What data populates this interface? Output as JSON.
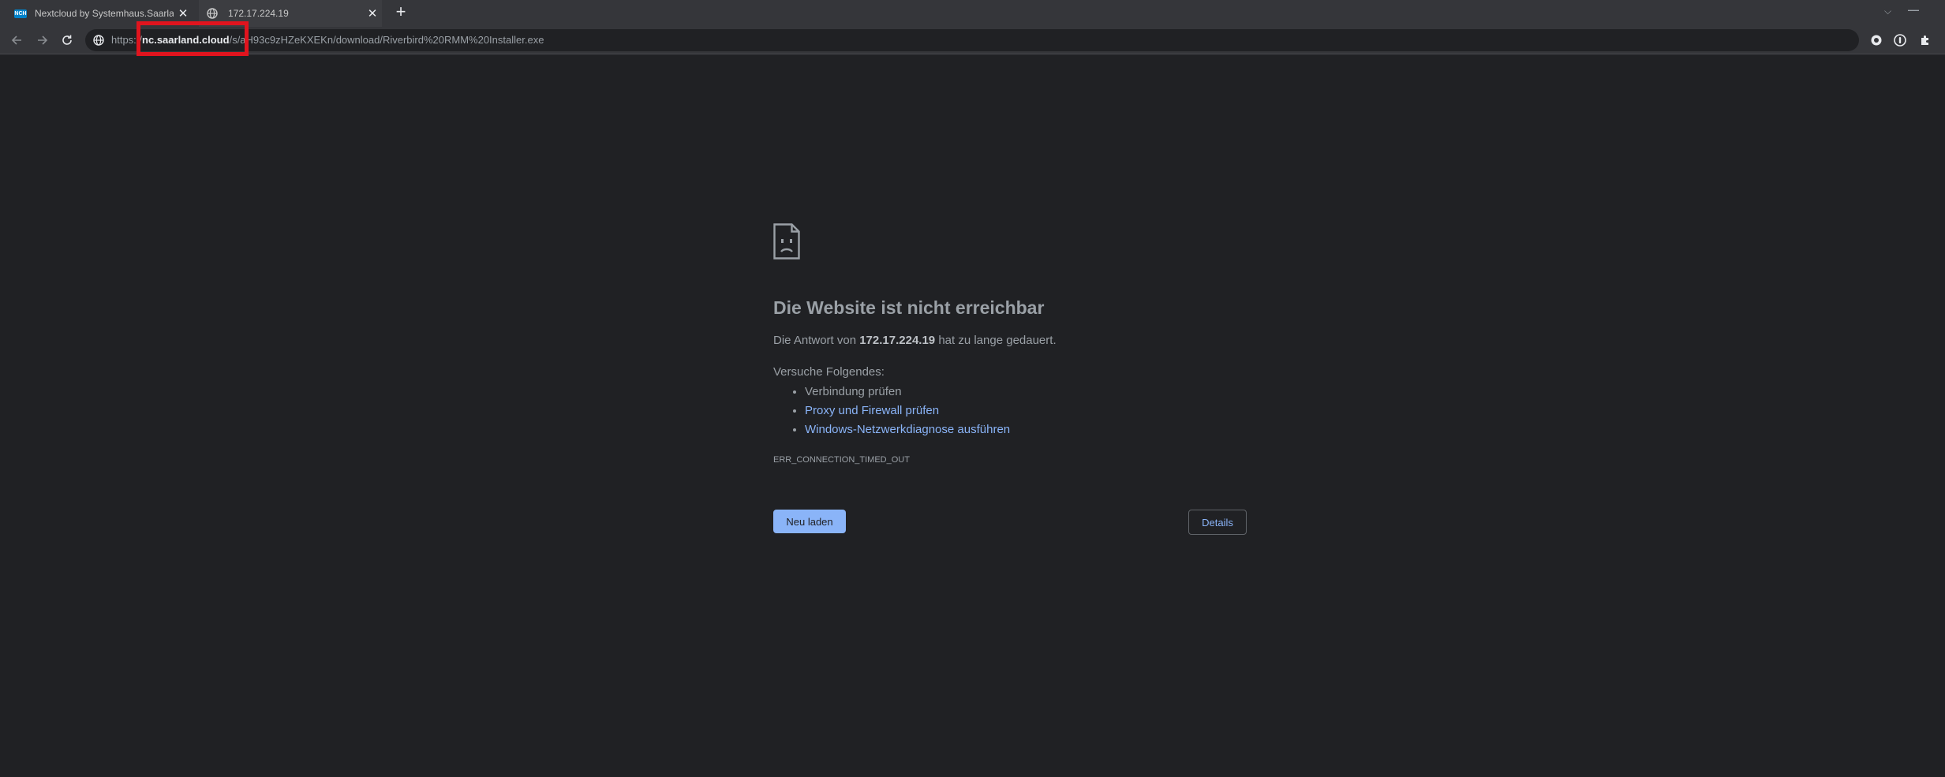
{
  "tabs": [
    {
      "title": "Nextcloud by Systemhaus.Saarland",
      "favicon_text": "NCH",
      "favicon": "nextcloud-icon"
    },
    {
      "title": "172.17.224.19",
      "favicon": "globe-icon"
    }
  ],
  "tab_close_glyph": "✕",
  "new_tab_glyph": "+",
  "window_controls": {
    "minimize": "—",
    "maximize": "☐",
    "close": "✕",
    "tab_search": "⌵"
  },
  "address_bar": {
    "scheme": "https://",
    "host": "nc.saarland.cloud",
    "path": "/s/aH93c9zHZeKXEKn/download/Riverbird%20RMM%20Installer.exe"
  },
  "error_page": {
    "icon": "sad-page-icon",
    "title": "Die Website ist nicht erreichbar",
    "summary_prefix": "Die Antwort von ",
    "summary_host": "172.17.224.19",
    "summary_suffix": " hat zu lange gedauert.",
    "try_label": "Versuche Folgendes:",
    "suggestions": [
      {
        "text": "Verbindung prüfen",
        "link": false
      },
      {
        "text": "Proxy und Firewall prüfen",
        "link": true
      },
      {
        "text": "Windows-Netzwerkdiagnose ausführen",
        "link": true
      }
    ],
    "error_code": "ERR_CONNECTION_TIMED_OUT",
    "reload_label": "Neu laden",
    "details_label": "Details"
  },
  "colors": {
    "background": "#202124",
    "link": "#8ab4f8",
    "highlight": "#e0141e",
    "nextcloud": "#0082c9"
  }
}
